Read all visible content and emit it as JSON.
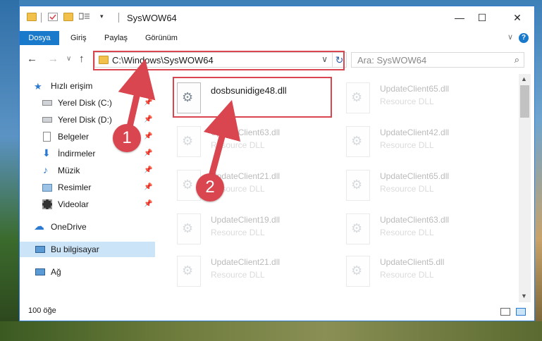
{
  "window": {
    "title": "SysWOW64"
  },
  "ribbon": {
    "tabs": [
      "Dosya",
      "Giriş",
      "Paylaş",
      "Görünüm"
    ]
  },
  "nav": {
    "path": "C:\\Windows\\SysWOW64",
    "search_placeholder": "Ara: SysWOW64"
  },
  "sidebar": {
    "items": [
      {
        "label": "Hızlı erişim",
        "icon": "star-icon"
      },
      {
        "label": "Yerel Disk (C:)",
        "icon": "drive-icon"
      },
      {
        "label": "Yerel Disk (D:)",
        "icon": "drive-icon"
      },
      {
        "label": "Belgeler",
        "icon": "document-icon"
      },
      {
        "label": "İndirmeler",
        "icon": "download-icon"
      },
      {
        "label": "Müzik",
        "icon": "music-icon"
      },
      {
        "label": "Resimler",
        "icon": "pictures-icon"
      },
      {
        "label": "Videolar",
        "icon": "video-icon"
      },
      {
        "label": "OneDrive",
        "icon": "cloud-icon"
      },
      {
        "label": "Bu bilgisayar",
        "icon": "computer-icon"
      },
      {
        "label": "Ağ",
        "icon": "network-icon"
      }
    ]
  },
  "files": [
    {
      "name": "dosbsunidige48.dll",
      "type": ""
    },
    {
      "name": "UpdateClient65.dll",
      "type": "Resource DLL"
    },
    {
      "name": "UpdateClient63.dll",
      "type": "Resource DLL"
    },
    {
      "name": "UpdateClient42.dll",
      "type": "Resource DLL"
    },
    {
      "name": "UpdateClient21.dll",
      "type": "Resource DLL"
    },
    {
      "name": "UpdateClient65.dll",
      "type": "Resource DLL"
    },
    {
      "name": "UpdateClient19.dll",
      "type": "Resource DLL"
    },
    {
      "name": "UpdateClient63.dll",
      "type": "Resource DLL"
    },
    {
      "name": "UpdateClient21.dll",
      "type": "Resource DLL"
    },
    {
      "name": "UpdateClient5.dll",
      "type": "Resource DLL"
    }
  ],
  "status": {
    "count": "100 öğe"
  },
  "annotations": {
    "step1": "1",
    "step2": "2",
    "color": "#d9464f"
  }
}
